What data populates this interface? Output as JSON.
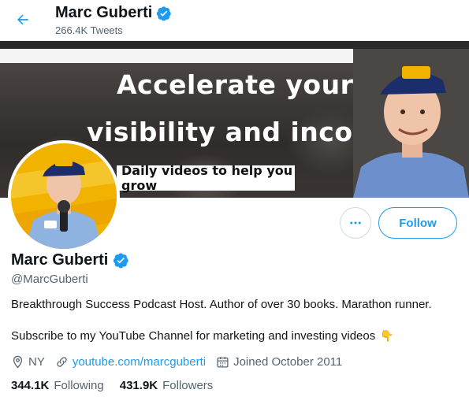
{
  "header": {
    "name": "Marc Guberti",
    "tweet_count": "266.4K Tweets"
  },
  "banner": {
    "headline_line1": "Accelerate your",
    "headline_line2": "visibility and income",
    "tagline": "Daily videos to help you grow"
  },
  "actions": {
    "more_label": "•••",
    "follow_label": "Follow"
  },
  "profile": {
    "name": "Marc Guberti",
    "handle": "@MarcGuberti",
    "bio_line1": "Breakthrough Success Podcast Host. Author of over 30 books. Marathon runner.",
    "bio_line2": "Subscribe to my YouTube Channel for marketing and investing videos",
    "bio_emoji": "👇",
    "location": "NY",
    "website": "youtube.com/marcguberti",
    "joined": "Joined October 2011"
  },
  "stats": {
    "following_count": "344.1K",
    "following_label": "Following",
    "followers_count": "431.9K",
    "followers_label": "Followers"
  },
  "colors": {
    "accent": "#1d9bf0",
    "text_primary": "#0f1419",
    "text_secondary": "#536471",
    "avatar_bg": "#f2b300"
  },
  "icons": [
    "back-arrow-icon",
    "verified-badge-icon",
    "more-dots-icon",
    "location-pin-icon",
    "link-icon",
    "calendar-icon"
  ]
}
